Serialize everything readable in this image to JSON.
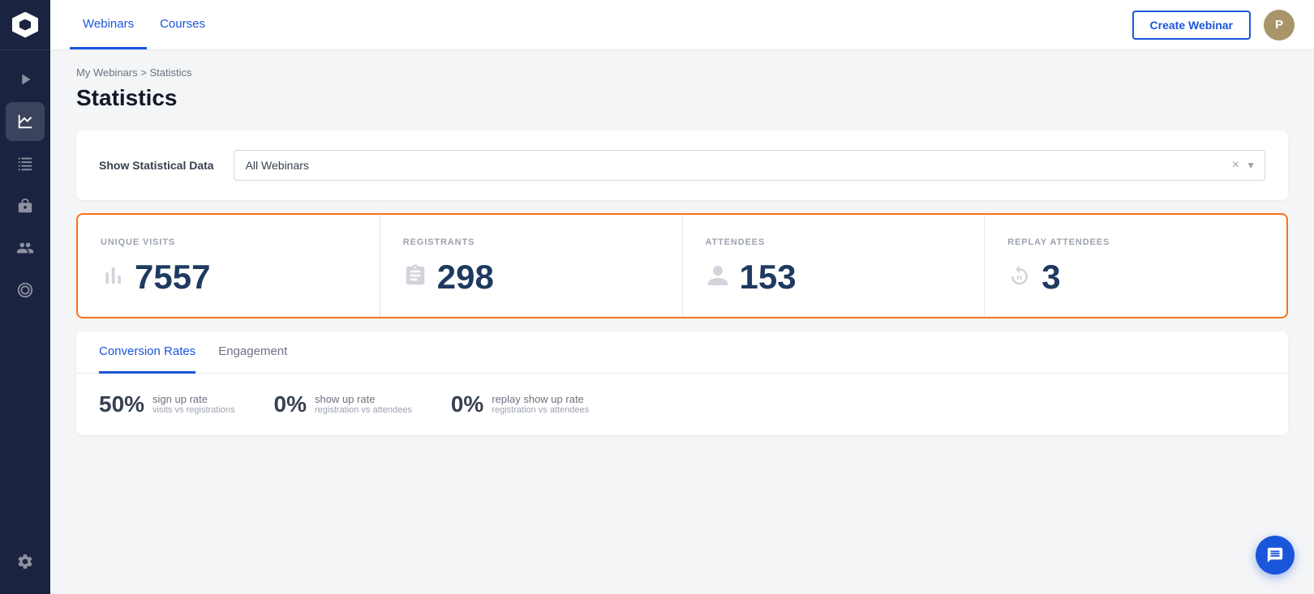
{
  "sidebar": {
    "logo_alt": "Logo",
    "nav_items": [
      {
        "id": "play",
        "label": "Play",
        "icon": "play-icon"
      },
      {
        "id": "chart",
        "label": "Statistics",
        "icon": "chart-icon",
        "active": true
      },
      {
        "id": "list",
        "label": "List",
        "icon": "list-icon"
      },
      {
        "id": "integration",
        "label": "Integration",
        "icon": "integration-icon"
      },
      {
        "id": "contacts",
        "label": "Contacts",
        "icon": "contacts-icon"
      },
      {
        "id": "settings-circle",
        "label": "Settings Circle",
        "icon": "settings-circle-icon"
      }
    ],
    "bottom_items": [
      {
        "id": "settings",
        "label": "Settings",
        "icon": "settings-icon"
      }
    ]
  },
  "topnav": {
    "tabs": [
      {
        "id": "webinars",
        "label": "Webinars",
        "active": true
      },
      {
        "id": "courses",
        "label": "Courses",
        "active": false
      }
    ],
    "create_button_label": "Create Webinar",
    "user_initial": "P"
  },
  "breadcrumb": {
    "parent_label": "My Webinars",
    "separator": ">",
    "current_label": "Statistics"
  },
  "page": {
    "title": "Statistics"
  },
  "filter": {
    "label": "Show Statistical Data",
    "select_value": "All Webinars",
    "placeholder": "All Webinars"
  },
  "stats": [
    {
      "id": "unique-visits",
      "label": "UNIQUE VISITS",
      "value": "7557",
      "icon": "bar-chart-icon"
    },
    {
      "id": "registrants",
      "label": "REGISTRANTS",
      "value": "298",
      "icon": "clipboard-icon"
    },
    {
      "id": "attendees",
      "label": "ATTENDEES",
      "value": "153",
      "icon": "person-icon"
    },
    {
      "id": "replay-attendees",
      "label": "REPLAY ATTENDEES",
      "value": "3",
      "icon": "replay-person-icon"
    }
  ],
  "tabs": {
    "items": [
      {
        "id": "conversion-rates",
        "label": "Conversion Rates",
        "active": true
      },
      {
        "id": "engagement",
        "label": "Engagement",
        "active": false
      }
    ]
  },
  "conversion_rates": [
    {
      "id": "sign-up",
      "percent": "50%",
      "main_label": "sign up rate",
      "sub_label": "visits vs registrations"
    },
    {
      "id": "show-up",
      "percent": "0%",
      "main_label": "show up rate",
      "sub_label": "registration vs attendees"
    },
    {
      "id": "replay-show-up",
      "percent": "0%",
      "main_label": "replay show up rate",
      "sub_label": "registration vs attendees"
    }
  ]
}
